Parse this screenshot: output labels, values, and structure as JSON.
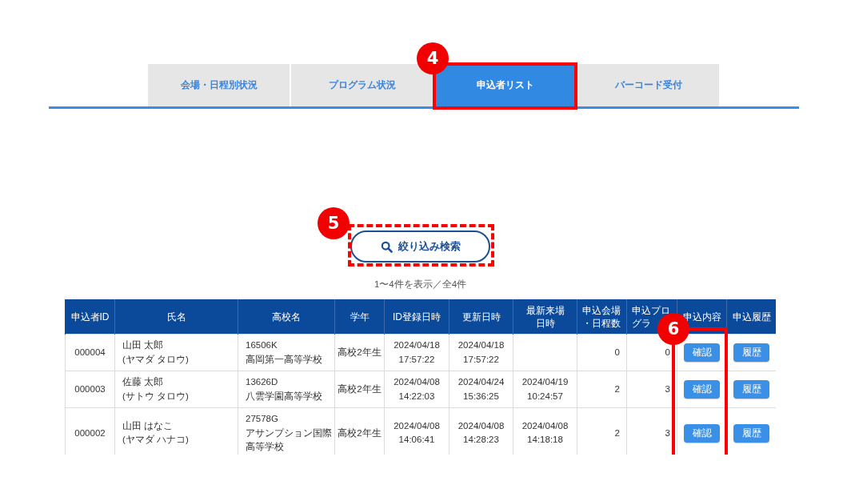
{
  "tabs": [
    {
      "label": "会場・日程別状況",
      "selected": false
    },
    {
      "label": "プログラム状況",
      "selected": false
    },
    {
      "label": "申込者リスト",
      "selected": true,
      "callout": {
        "badge": "4",
        "dashed": false
      }
    },
    {
      "label": "バーコード受付",
      "selected": false
    }
  ],
  "search_button": {
    "label": "絞り込み検索",
    "callout": {
      "badge": "5",
      "dashed": true
    }
  },
  "result_count": "1〜4件を表示／全4件",
  "table": {
    "columns": [
      {
        "label": "申込者ID",
        "kind": "center"
      },
      {
        "label": "氏名",
        "kind": "text"
      },
      {
        "label": "高校名",
        "kind": "text"
      },
      {
        "label": "学年",
        "kind": "center"
      },
      {
        "label": "ID登録日時",
        "kind": "center"
      },
      {
        "label": "更新日時",
        "kind": "center"
      },
      {
        "label": "最新来場日時",
        "kind": "center"
      },
      {
        "label": "申込会場・日程数",
        "kind": "number"
      },
      {
        "label": "申込プログラ",
        "kind": "number"
      },
      {
        "label": "申込内容",
        "kind": "button",
        "callout": {
          "badge": "6",
          "dashed": false
        }
      },
      {
        "label": "申込履歴",
        "kind": "button"
      }
    ],
    "rows": [
      {
        "applicant_id": "000004",
        "name": "山田 太郎\n(ヤマダ タロウ)",
        "school": "16506K\n高岡第一高等学校",
        "grade": "高校2年生",
        "id_registered": "2024/04/18\n17:57:22",
        "updated": "2024/04/18\n17:57:22",
        "venue_schedule_count": "0",
        "program_count": "0",
        "details_button": "確認",
        "history_button": "履歴"
      },
      {
        "applicant_id": "000003",
        "name": "佐藤 太郎\n(サトウ タロウ)",
        "school": "13626D\n八雲学園高等学校",
        "grade": "高校2年生",
        "id_registered": "2024/04/08\n14:22:03",
        "updated": "2024/04/24\n15:36:25",
        "last_visit": "2024/04/19\n10:24:57",
        "venue_schedule_count": "2",
        "program_count": "3",
        "details_button": "確認",
        "history_button": "履歴"
      },
      {
        "applicant_id": "000002",
        "name": "山田 はなこ\n(ヤマダ ハナコ)",
        "school": "27578G\nアサンプション国際高等学校",
        "grade": "高校2年生",
        "id_registered": "2024/04/08\n14:06:41",
        "updated": "2024/04/08\n14:28:23",
        "last_visit": "2024/04/08\n14:18:18",
        "venue_schedule_count": "2",
        "program_count": "3",
        "details_button": "確認",
        "history_button": "履歴"
      }
    ]
  }
}
